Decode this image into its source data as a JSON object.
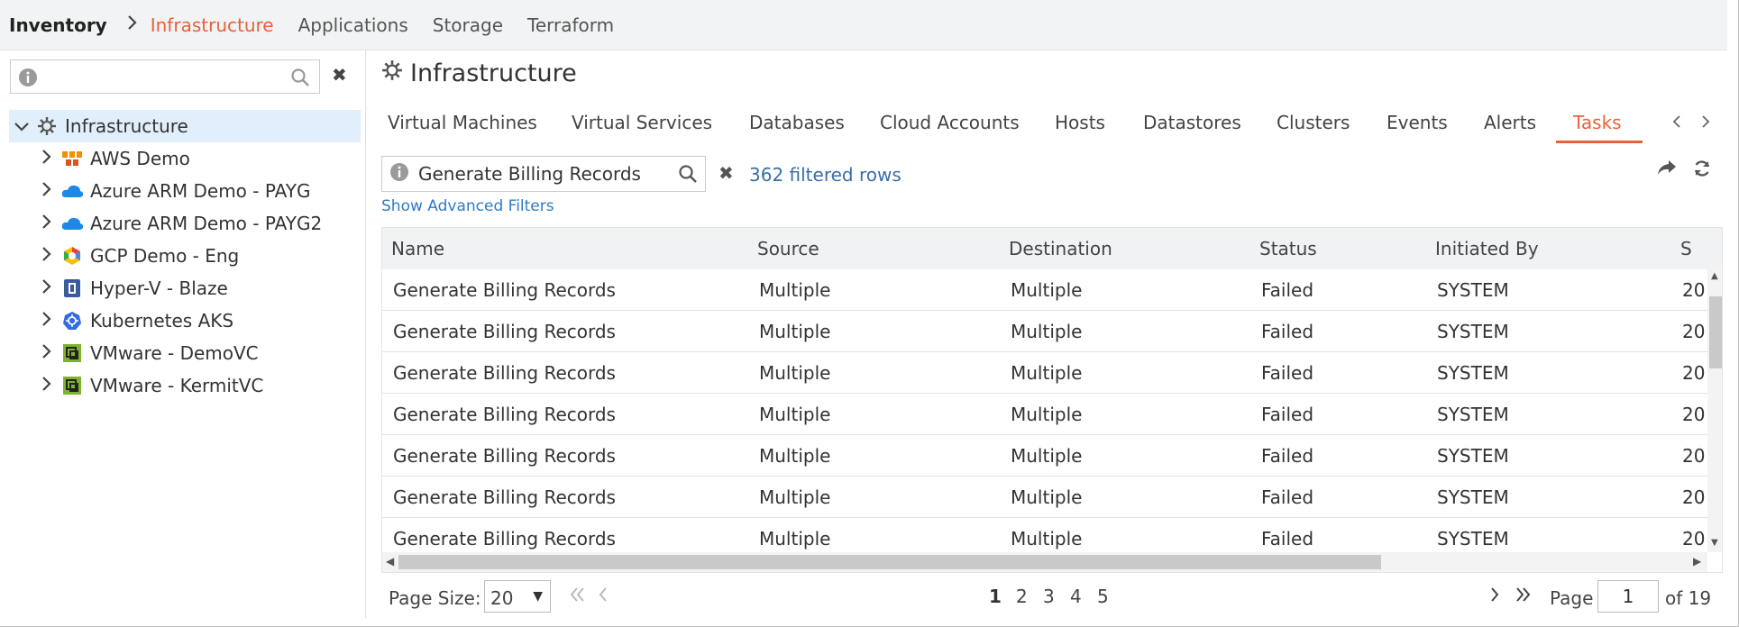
{
  "topnav": {
    "brand": "Inventory",
    "items": [
      {
        "label": "Infrastructure",
        "active": true
      },
      {
        "label": "Applications",
        "active": false
      },
      {
        "label": "Storage",
        "active": false
      },
      {
        "label": "Terraform",
        "active": false
      }
    ]
  },
  "sidebar": {
    "search": {
      "value": "",
      "placeholder": ""
    },
    "tree": {
      "root": {
        "label": "Infrastructure",
        "icon": "gear-icon",
        "expanded": true
      },
      "children": [
        {
          "label": "AWS Demo",
          "icon": "aws-icon"
        },
        {
          "label": "Azure ARM Demo - PAYG",
          "icon": "azure-cloud-icon"
        },
        {
          "label": "Azure ARM Demo - PAYG2",
          "icon": "azure-cloud-icon"
        },
        {
          "label": "GCP Demo - Eng",
          "icon": "gcp-icon"
        },
        {
          "label": "Hyper-V - Blaze",
          "icon": "hyperv-icon"
        },
        {
          "label": "Kubernetes AKS",
          "icon": "kubernetes-icon"
        },
        {
          "label": "VMware - DemoVC",
          "icon": "vmware-icon"
        },
        {
          "label": "VMware - KermitVC",
          "icon": "vmware-icon"
        }
      ]
    }
  },
  "main": {
    "title": "Infrastructure",
    "tabs": [
      {
        "label": "Virtual Machines",
        "active": false
      },
      {
        "label": "Virtual Services",
        "active": false
      },
      {
        "label": "Databases",
        "active": false
      },
      {
        "label": "Cloud Accounts",
        "active": false
      },
      {
        "label": "Hosts",
        "active": false
      },
      {
        "label": "Datastores",
        "active": false
      },
      {
        "label": "Clusters",
        "active": false
      },
      {
        "label": "Events",
        "active": false
      },
      {
        "label": "Alerts",
        "active": false
      },
      {
        "label": "Tasks",
        "active": true
      }
    ],
    "filter": {
      "value": "Generate Billing Records",
      "count_text": "362 filtered rows",
      "advanced_link": "Show Advanced Filters"
    },
    "table": {
      "columns": [
        "Name",
        "Source",
        "Destination",
        "Status",
        "Initiated By",
        "S"
      ],
      "rows": [
        [
          "Generate Billing Records",
          "Multiple",
          "Multiple",
          "Failed",
          "SYSTEM",
          "20"
        ],
        [
          "Generate Billing Records",
          "Multiple",
          "Multiple",
          "Failed",
          "SYSTEM",
          "20"
        ],
        [
          "Generate Billing Records",
          "Multiple",
          "Multiple",
          "Failed",
          "SYSTEM",
          "20"
        ],
        [
          "Generate Billing Records",
          "Multiple",
          "Multiple",
          "Failed",
          "SYSTEM",
          "20"
        ],
        [
          "Generate Billing Records",
          "Multiple",
          "Multiple",
          "Failed",
          "SYSTEM",
          "20"
        ],
        [
          "Generate Billing Records",
          "Multiple",
          "Multiple",
          "Failed",
          "SYSTEM",
          "20"
        ],
        [
          "Generate Billing Records",
          "Multiple",
          "Multiple",
          "Failed",
          "SYSTEM",
          "20"
        ]
      ]
    },
    "pager": {
      "page_size_label": "Page Size:",
      "page_size": "20",
      "pages": [
        "1",
        "2",
        "3",
        "4",
        "5"
      ],
      "current_page": "1",
      "page_label": "Page",
      "page_input": "1",
      "of_label": "of 19"
    }
  },
  "colors": {
    "accent": "#e8623a",
    "link": "#2e7bc4",
    "selected_row": "#e1eefb"
  }
}
